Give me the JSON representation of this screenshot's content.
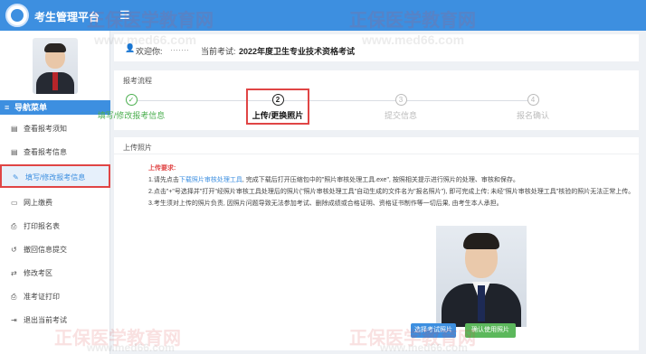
{
  "app": {
    "title": "考生管理平台",
    "menu_icon": "hamburger-icon"
  },
  "user": {
    "welcome_label": "欢迎你:",
    "name": "·······",
    "current_exam_label": "当前考试:",
    "current_exam": "2022年度卫生专业技术资格考试"
  },
  "sidebar": {
    "header": "导航菜单",
    "items": [
      {
        "label": "查看报考须知",
        "icon": "document-icon",
        "active": false
      },
      {
        "label": "查看报考信息",
        "icon": "document-icon",
        "active": false
      },
      {
        "label": "填写/修改报考信息",
        "icon": "edit-icon",
        "active": true
      },
      {
        "label": "网上缴费",
        "icon": "payment-icon",
        "active": false
      },
      {
        "label": "打印报名表",
        "icon": "print-icon",
        "active": false
      },
      {
        "label": "撤回信息提交",
        "icon": "undo-icon",
        "active": false
      },
      {
        "label": "修改考区",
        "icon": "swap-icon",
        "active": false
      },
      {
        "label": "准考证打印",
        "icon": "print-icon",
        "active": false
      },
      {
        "label": "退出当前考试",
        "icon": "exit-icon",
        "active": false
      }
    ]
  },
  "process": {
    "title": "报考流程",
    "steps": [
      {
        "num": "✓",
        "label": "填写/修改报考信息",
        "state": "done"
      },
      {
        "num": "2",
        "label": "上传/更换照片",
        "state": "current"
      },
      {
        "num": "3",
        "label": "提交信息",
        "state": "pending"
      },
      {
        "num": "4",
        "label": "报名确认",
        "state": "pending"
      }
    ]
  },
  "upload": {
    "title": "上传照片",
    "tips_title": "上传要求:",
    "tip1_a": "1.请先点击",
    "tip1_link": "下载照片审核处理工具",
    "tip1_b": ", 完成下载后打开压缩包中的\"照片审核处理工具.exe\", 按照相关提示进行照片的处理、审核和保存。",
    "tip2": "2.点击\"+\"号选择并\"打开\"经照片审核工具处理后的照片(\"照片审核处理工具\"自动生成的文件名为\"报名照片\"), 即可完成上传; 未经\"照片审核处理工具\"核验的照片无法正常上传。",
    "tip3": "3.考生须对上传的照片负责, 因照片问题导致无法参加考试、删除成绩或合格证明、资格证书制作等一切后果, 由考生本人承担。",
    "select_button": "选择考试照片",
    "confirm_button": "确认使用照片"
  },
  "watermark": {
    "brand": "正保医学教育网",
    "url": "www.med66.com"
  },
  "colors": {
    "primary": "#3d8fe0",
    "success": "#5cb85c",
    "highlight": "#e04545"
  }
}
